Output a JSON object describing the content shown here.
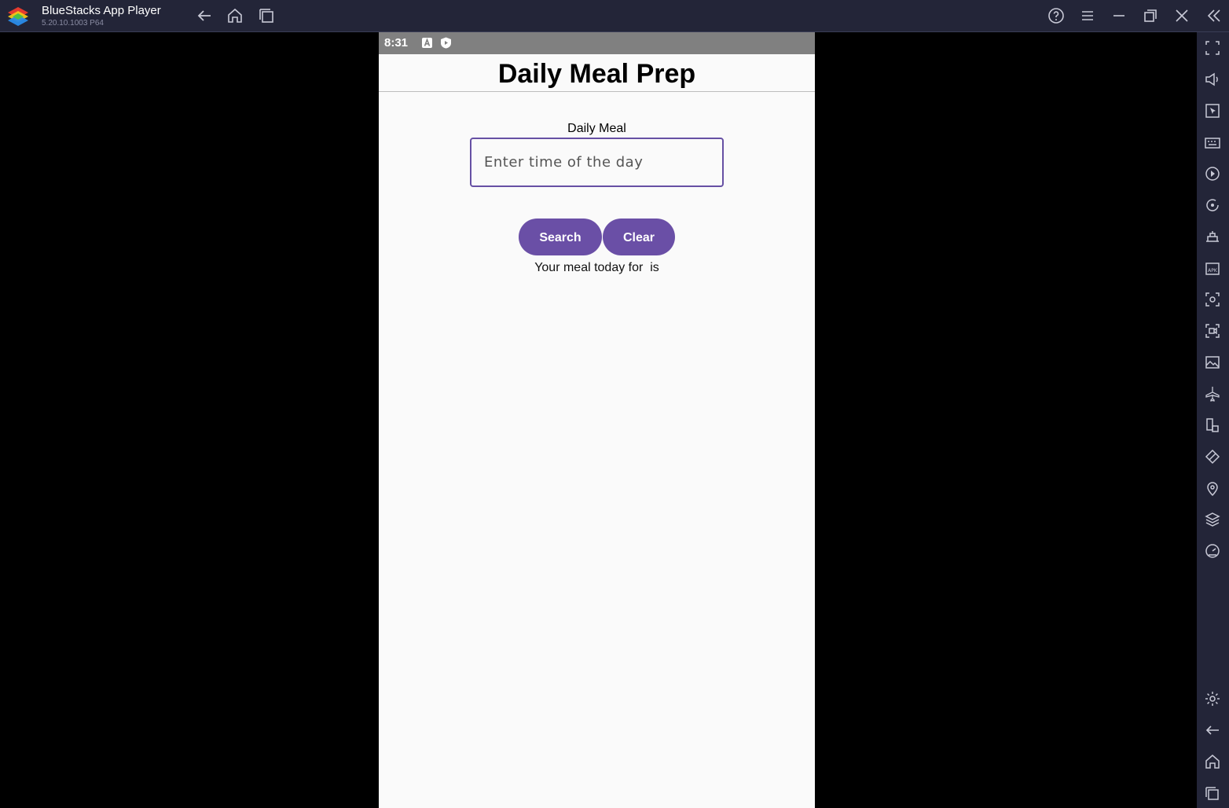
{
  "window": {
    "title": "BlueStacks App Player",
    "version": "5.20.10.1003",
    "arch": "P64"
  },
  "titlebar_icons": [
    "back-icon",
    "home-icon",
    "recent-apps-icon",
    "help-icon",
    "menu-icon",
    "minimize-icon",
    "restore-icon",
    "close-icon",
    "collapse-sidebar-icon"
  ],
  "sidebar_icons": [
    "fullscreen-icon",
    "volume-icon",
    "pointer-icon",
    "keyboard-icon",
    "macro-icon",
    "rotate-sync-icon",
    "screen-record-icon",
    "apk-install-icon",
    "screenshot-icon",
    "video-record-icon",
    "media-folder-icon",
    "airplane-mode-icon",
    "multi-instance-icon",
    "eco-mode-icon",
    "location-icon",
    "layers-icon",
    "performance-icon",
    "settings-icon",
    "back-icon",
    "home-icon",
    "recent-apps-icon"
  ],
  "status_bar": {
    "time": "8:31"
  },
  "app": {
    "title": "Daily Meal Prep",
    "field_label": "Daily Meal",
    "input_placeholder": "Enter time of the day",
    "input_value": "",
    "search_label": "Search",
    "clear_label": "Clear",
    "result_text": "Your meal today for  is"
  },
  "colors": {
    "accent": "#6a4fa6",
    "input_border": "#6650a4",
    "titlebar_bg": "#232538",
    "status_bar_bg": "#808080"
  }
}
